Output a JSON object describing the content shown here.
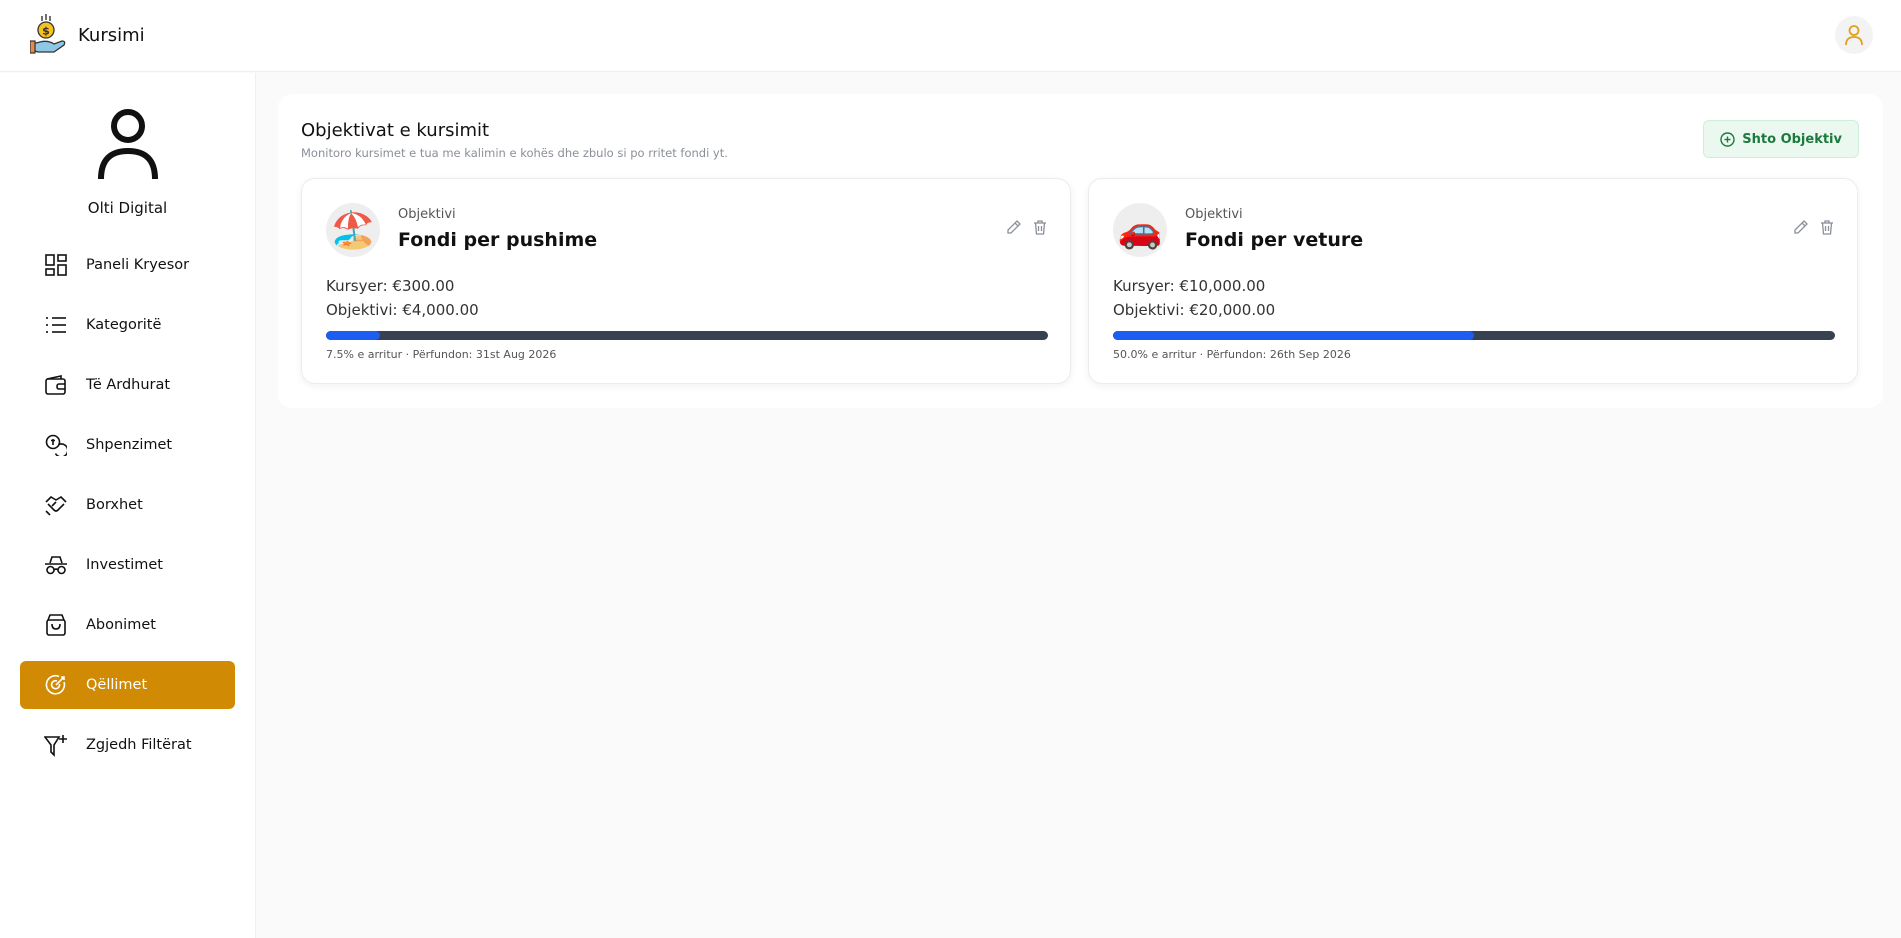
{
  "app": {
    "name": "Kursimi"
  },
  "user": {
    "name": "Olti Digital"
  },
  "sidebar": {
    "items": [
      {
        "label": "Paneli Kryesor",
        "icon": "dashboard-icon",
        "active": false
      },
      {
        "label": "Kategoritë",
        "icon": "list-icon",
        "active": false
      },
      {
        "label": "Të Ardhurat",
        "icon": "wallet-icon",
        "active": false
      },
      {
        "label": "Shpenzimet",
        "icon": "coins-icon",
        "active": false
      },
      {
        "label": "Borxhet",
        "icon": "handshake-icon",
        "active": false
      },
      {
        "label": "Investimet",
        "icon": "incognito-icon",
        "active": false
      },
      {
        "label": "Abonimet",
        "icon": "shopping-bag-icon",
        "active": false
      },
      {
        "label": "Qëllimet",
        "icon": "target-icon",
        "active": true
      },
      {
        "label": "Zgjedh Filtërat",
        "icon": "filter-icon",
        "active": false
      }
    ]
  },
  "main": {
    "title": "Objektivat e kursimit",
    "subtitle": "Monitoro kursimet e tua me kalimin e kohës dhe zbulo si po rritet fondi yt.",
    "add_label": "Shto Objektiv"
  },
  "goals": [
    {
      "emoji": "🏖️",
      "kicker": "Objektivi",
      "name": "Fondi per pushime",
      "saved": "Kursyer: €300.00",
      "target": "Objektivi: €4,000.00",
      "progress": 0.075,
      "meta": "7.5% e arritur · Përfundon: 31st Aug 2026"
    },
    {
      "emoji": "🚗",
      "kicker": "Objektivi",
      "name": "Fondi per veture",
      "saved": "Kursyer: €10,000.00",
      "target": "Objektivi: €20,000.00",
      "progress": 0.5,
      "meta": "50.0% e arritur · Përfundon: 26th Sep 2026"
    }
  ],
  "colors": {
    "accent": "#d08a04",
    "progress": "#1d5ef0",
    "track": "#374151",
    "add_button": "#1c7a3d"
  }
}
